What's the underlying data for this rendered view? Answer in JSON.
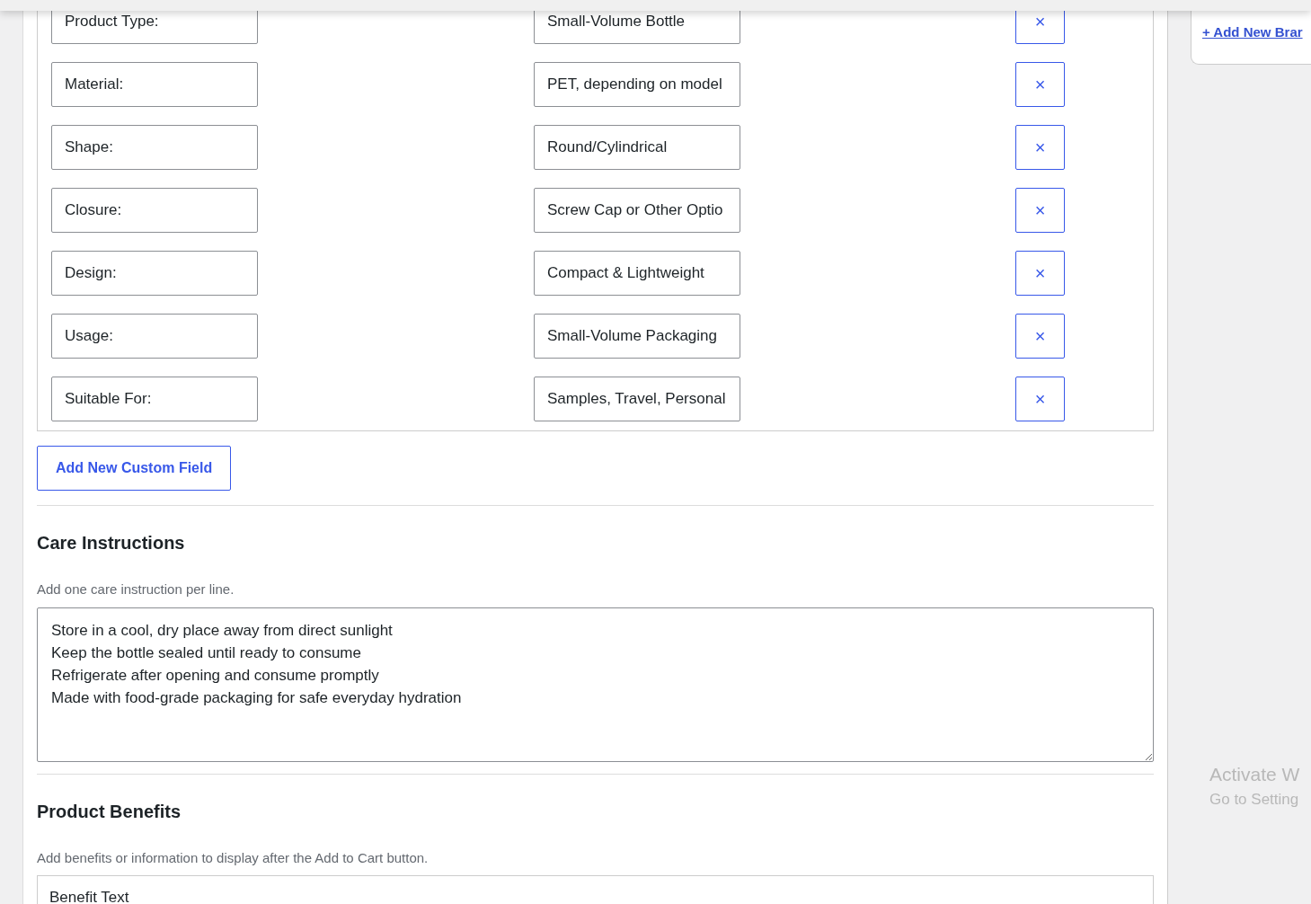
{
  "custom_fields": [
    {
      "label": "Product Type:",
      "value": "Small-Volume Bottle",
      "remove": "×"
    },
    {
      "label": "Material:",
      "value": "PET, depending on model",
      "remove": "×"
    },
    {
      "label": "Shape:",
      "value": "Round/Cylindrical",
      "remove": "×"
    },
    {
      "label": "Closure:",
      "value": "Screw Cap or Other Optio",
      "remove": "×"
    },
    {
      "label": "Design:",
      "value": "Compact & Lightweight",
      "remove": "×"
    },
    {
      "label": "Usage:",
      "value": "Small-Volume Packaging",
      "remove": "×"
    },
    {
      "label": "Suitable For:",
      "value": "Samples, Travel, Personal",
      "remove": "×"
    }
  ],
  "add_field_button": "Add New Custom Field",
  "care": {
    "title": "Care Instructions",
    "hint": "Add one care instruction per line.",
    "text": "Store in a cool, dry place away from direct sunlight\nKeep the bottle sealed until ready to consume\nRefrigerate after opening and consume promptly\nMade with food-grade packaging for safe everyday hydration"
  },
  "benefits": {
    "title": "Product Benefits",
    "hint": "Add benefits or information to display after the Add to Cart button.",
    "columns": [
      "Benefit Text"
    ]
  },
  "sidebar": {
    "add_brand_link": "+ Add New Brar"
  },
  "os_notice": {
    "title": "Activate W",
    "subtitle": "Go to Setting"
  }
}
